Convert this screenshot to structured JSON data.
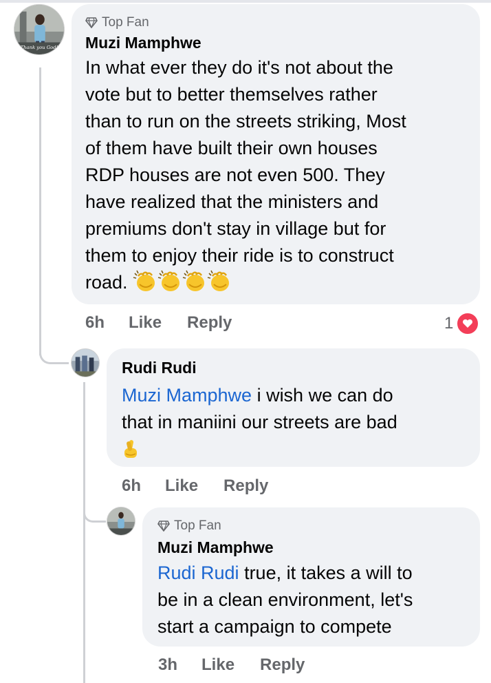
{
  "comment1": {
    "badge": "Top Fan",
    "author": "Muzi Mamphwe",
    "lines": [
      "In what ever they do it's not about the",
      "vote but to better themselves rather",
      "than to run on the streets striking, Most",
      "of them have built their own houses",
      "RDP houses are not even 500. They",
      "have realized that the ministers and",
      "premiums don't stay in village but for",
      "them to enjoy their ride is to construct"
    ],
    "last_line": "road.",
    "emoji": "clapping-hands x4",
    "time": "6h",
    "like": "Like",
    "reply": "Reply",
    "reaction_count": "1",
    "reaction": "heart-icon",
    "avatar_caption": "Thank you God!"
  },
  "reply1": {
    "author": "Rudi Rudi",
    "mention": "Muzi Mamphwe",
    "line1_rest": " i wish we can do",
    "line2": "that in maniini our streets are bad",
    "emoji": "crossed-fingers",
    "time": "6h",
    "like": "Like",
    "reply": "Reply"
  },
  "reply2": {
    "badge": "Top Fan",
    "author": "Muzi Mamphwe",
    "mention": "Rudi Rudi",
    "line1_rest": " true, it takes a will to",
    "line2": "be in a clean environment, let's",
    "line3": "start a campaign to compete",
    "time": "3h",
    "like": "Like",
    "reply": "Reply"
  },
  "colors": {
    "bubble": "#f0f2f5",
    "mention": "#1b66d1",
    "meta": "#65676b",
    "heart": "#f33e58",
    "thread": "#ced0d4"
  }
}
